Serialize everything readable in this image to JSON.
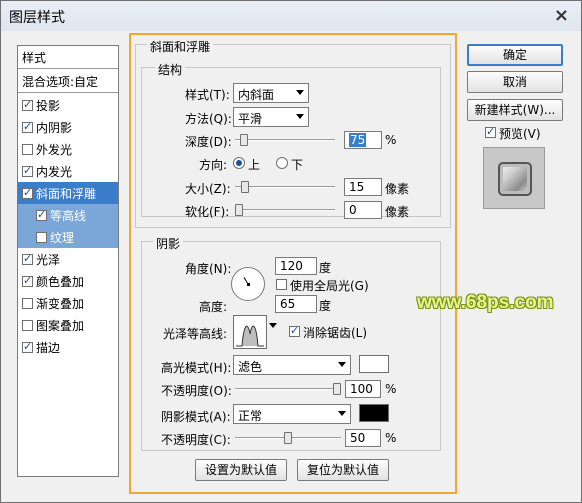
{
  "window": {
    "title": "图层样式",
    "close_glyph": "×"
  },
  "left_panel": {
    "header": "样式",
    "blend": "混合选项:自定",
    "items": [
      {
        "label": "投影",
        "checked": true,
        "selected": false,
        "sub": false
      },
      {
        "label": "内阴影",
        "checked": true,
        "selected": false,
        "sub": false
      },
      {
        "label": "外发光",
        "checked": false,
        "selected": false,
        "sub": false
      },
      {
        "label": "内发光",
        "checked": true,
        "selected": false,
        "sub": false
      },
      {
        "label": "斜面和浮雕",
        "checked": true,
        "selected": true,
        "sub": false
      },
      {
        "label": "等高线",
        "checked": true,
        "selected": false,
        "sub": true
      },
      {
        "label": "纹理",
        "checked": false,
        "selected": false,
        "sub": true
      },
      {
        "label": "光泽",
        "checked": true,
        "selected": false,
        "sub": false
      },
      {
        "label": "颜色叠加",
        "checked": true,
        "selected": false,
        "sub": false
      },
      {
        "label": "渐变叠加",
        "checked": false,
        "selected": false,
        "sub": false
      },
      {
        "label": "图案叠加",
        "checked": false,
        "selected": false,
        "sub": false
      },
      {
        "label": "描边",
        "checked": true,
        "selected": false,
        "sub": false
      }
    ]
  },
  "bevel": {
    "title": "斜面和浮雕",
    "structure": {
      "title": "结构",
      "style_label": "样式(T):",
      "style_value": "内斜面",
      "method_label": "方法(Q):",
      "method_value": "平滑",
      "depth_label": "深度(D):",
      "depth_value": "75",
      "depth_unit": "%",
      "direction_label": "方向:",
      "direction_up": "上",
      "direction_down": "下",
      "size_label": "大小(Z):",
      "size_value": "15",
      "size_unit": "像素",
      "soften_label": "软化(F):",
      "soften_value": "0",
      "soften_unit": "像素"
    },
    "shading": {
      "title": "阴影",
      "angle_label": "角度(N):",
      "angle_value": "120",
      "angle_unit": "度",
      "global_light": "使用全局光(G)",
      "altitude_label": "高度:",
      "altitude_value": "65",
      "altitude_unit": "度",
      "gloss_label": "光泽等高线:",
      "antialias": "消除锯齿(L)",
      "highlight_label": "高光模式(H):",
      "highlight_value": "滤色",
      "highlight_color": "#ffffff",
      "hl_opacity_label": "不透明度(O):",
      "hl_opacity_value": "100",
      "hl_opacity_unit": "%",
      "shadow_label": "阴影模式(A):",
      "shadow_value": "正常",
      "shadow_color": "#000000",
      "sh_opacity_label": "不透明度(C):",
      "sh_opacity_value": "50",
      "sh_opacity_unit": "%"
    },
    "set_default": "设置为默认值",
    "reset_default": "复位为默认值"
  },
  "right": {
    "ok": "确定",
    "cancel": "取消",
    "new_style": "新建样式(W)...",
    "preview_label": "预览(V)"
  },
  "watermark": "www.68ps.com",
  "sliders": {
    "depth": 0.05,
    "size": 0.06,
    "soften": 0.0,
    "hl_opacity": 1.0,
    "sh_opacity": 0.5
  }
}
